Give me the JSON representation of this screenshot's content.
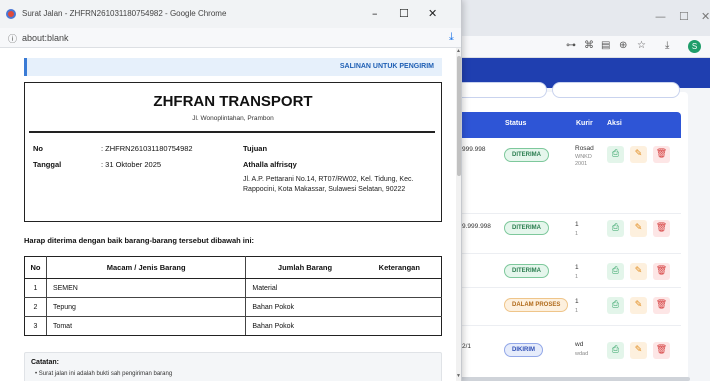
{
  "popup": {
    "window_title": "Surat Jalan - ZHFRN261031180754982 - Google Chrome",
    "minimize": "–",
    "maximize": "☐",
    "close": "✕",
    "url": "about:blank",
    "copy_banner": "SALINAN UNTUK PENGIRIM",
    "company": "ZHFRAN TRANSPORT",
    "company_address": "Jl. Wonoplintahan, Prambon",
    "no_label": "No",
    "no_value": ": ZHFRN261031180754982",
    "date_label": "Tanggal",
    "date_value": ": 31 Oktober 2025",
    "dest_label": "Tujuan",
    "dest_name": "Athalla alfrisqy",
    "dest_address": "Jl. A.P. Pettarani No.14, RT07/RW02, Kel. Tidung, Kec. Rappocini, Kota Makassar, Sulawesi Selatan, 90222",
    "intro": "Harap diterima dengan baik barang-barang tersebut dibawah ini:",
    "table_headers": {
      "no": "No",
      "name": "Macam / Jenis Barang",
      "qty": "Jumlah Barang",
      "note": "Keterangan"
    },
    "items": [
      {
        "no": "1",
        "name": "SEMEN",
        "qty": "Material",
        "note": ""
      },
      {
        "no": "2",
        "name": "Tepung",
        "qty": "Bahan Pokok",
        "note": ""
      },
      {
        "no": "3",
        "name": "Tomat",
        "qty": "Bahan Pokok",
        "note": ""
      }
    ],
    "notes_title": "Catatan:",
    "notes_item": "• Surat jalan ini adalah bukti sah pengiriman barang"
  },
  "background": {
    "window_min": "—",
    "window_max": "☐",
    "window_close": "✕",
    "toolbar_icons": [
      "⊶",
      "⌘",
      "▤",
      "⊕",
      "☆",
      "⤓"
    ],
    "avatar": "S",
    "headers": {
      "status": "Status",
      "courier": "Kurir",
      "action": "Aksi"
    },
    "rows": [
      {
        "partial": "999.998",
        "status": "DITERIMA",
        "courier": "Rosad",
        "courier_sub": "WNKD 2001"
      },
      {
        "partial": "9.999.998",
        "status": "DITERIMA",
        "courier": "1",
        "courier_sub": "1"
      },
      {
        "partial": "",
        "status": "DITERIMA",
        "courier": "1",
        "courier_sub": "1"
      },
      {
        "partial": "",
        "status": "DALAM PROSES",
        "courier": "1",
        "courier_sub": "1"
      },
      {
        "partial": "2/1",
        "status": "DIKIRIM",
        "courier": "wd",
        "courier_sub": "wdad"
      }
    ],
    "colors": {
      "navbar": "#1f3fb0",
      "table_header": "#2e55d6",
      "green": "#2a7d4f",
      "orange": "#b06a1a",
      "blue": "#2f4fb5"
    }
  }
}
